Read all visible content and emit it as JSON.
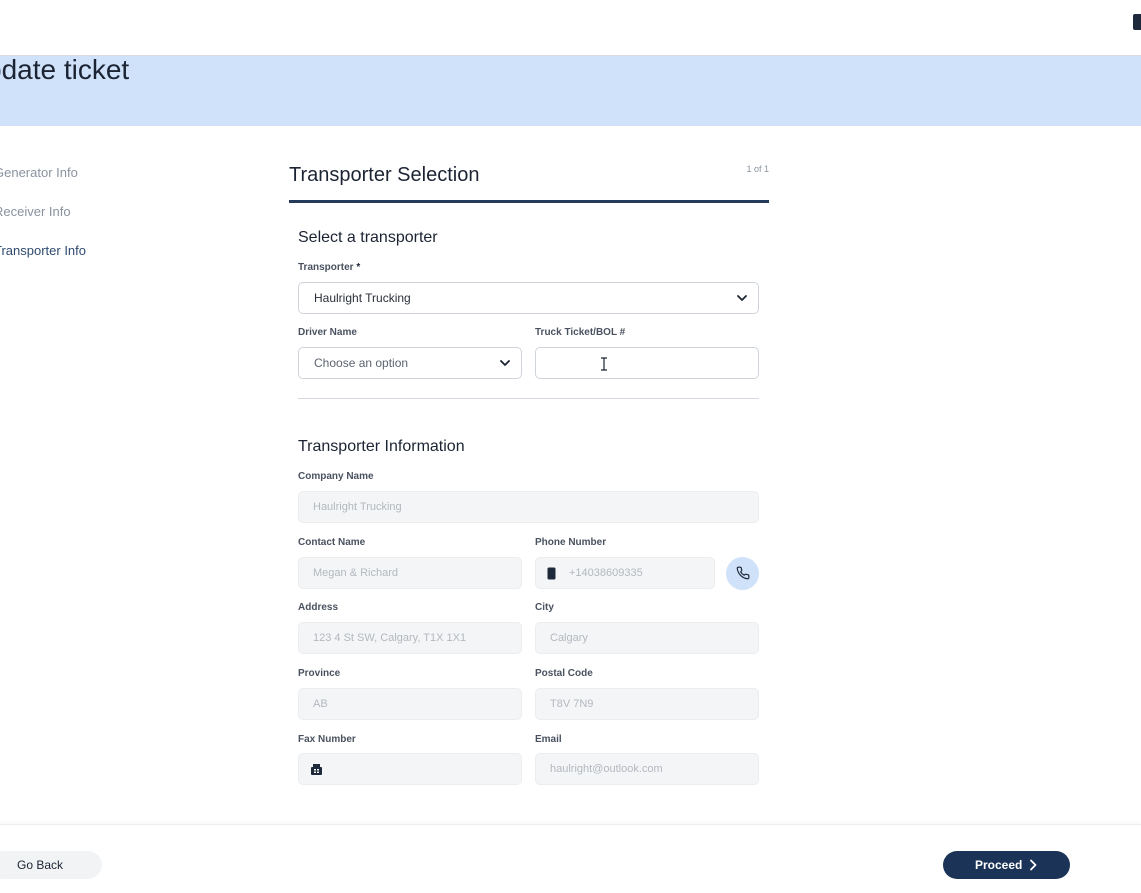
{
  "header": {
    "title": "pdate ticket"
  },
  "steps": [
    "Generator Info",
    "Receiver Info",
    "Transporter Info"
  ],
  "panel": {
    "title": "Transporter Selection",
    "page_count": "1 of 1"
  },
  "select_section": {
    "title": "Select a transporter",
    "transporter_label": "Transporter",
    "required_mark": "*",
    "transporter_value": "Haulright Trucking",
    "driver_label": "Driver Name",
    "driver_placeholder": "Choose an option",
    "ticket_label": "Truck Ticket/BOL #",
    "ticket_value": ""
  },
  "info_section": {
    "title": "Transporter Information",
    "company_label": "Company Name",
    "company_value": "Haulright Trucking",
    "contact_label": "Contact Name",
    "contact_value": "Megan & Richard",
    "phone_label": "Phone Number",
    "phone_value": "+14038609335",
    "address_label": "Address",
    "address_value": "123 4 St SW, Calgary, T1X 1X1",
    "city_label": "City",
    "city_value": "Calgary",
    "province_label": "Province",
    "province_value": "AB",
    "postal_label": "Postal Code",
    "postal_value": "T8V 7N9",
    "fax_label": "Fax Number",
    "fax_value": "",
    "email_label": "Email",
    "email_value": "haulright@outlook.com"
  },
  "footer": {
    "back_label": "Go Back",
    "proceed_label": "Proceed"
  },
  "colors": {
    "banner": "#cfe2fa",
    "primary": "#1b3357",
    "rule": "#243b5c"
  }
}
